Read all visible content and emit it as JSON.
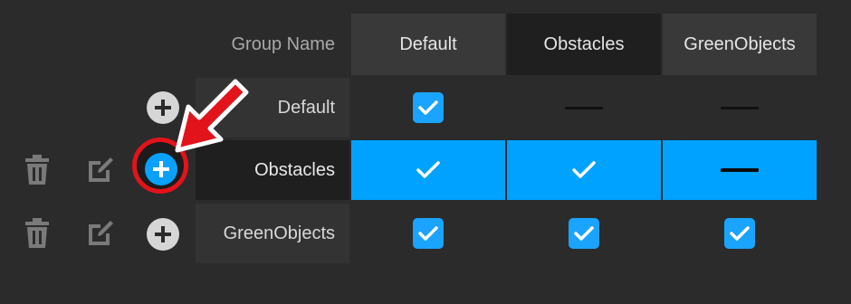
{
  "header": {
    "group_name_label": "Group Name",
    "columns": [
      "Default",
      "Obstacles",
      "GreenObjects"
    ]
  },
  "rows": [
    {
      "label": "Default",
      "cells": [
        "checked",
        "dash",
        "dash"
      ],
      "selected": false,
      "has_delete": false,
      "has_edit": false
    },
    {
      "label": "Obstacles",
      "cells": [
        "checked",
        "checked",
        "dash"
      ],
      "selected": true,
      "has_delete": true,
      "has_edit": true
    },
    {
      "label": "GreenObjects",
      "cells": [
        "checked",
        "checked",
        "checked"
      ],
      "selected": false,
      "has_delete": true,
      "has_edit": true
    }
  ],
  "icons": {
    "add": "plus-circle-icon",
    "delete": "trash-icon",
    "edit": "edit-icon",
    "check": "checkmark-icon",
    "annotation": "red-arrow-annotation"
  },
  "colors": {
    "background": "#2b2b2b",
    "selection": "#00a2ff",
    "checkbox": "#1aa3ff",
    "annotation_red": "#e3131b"
  }
}
